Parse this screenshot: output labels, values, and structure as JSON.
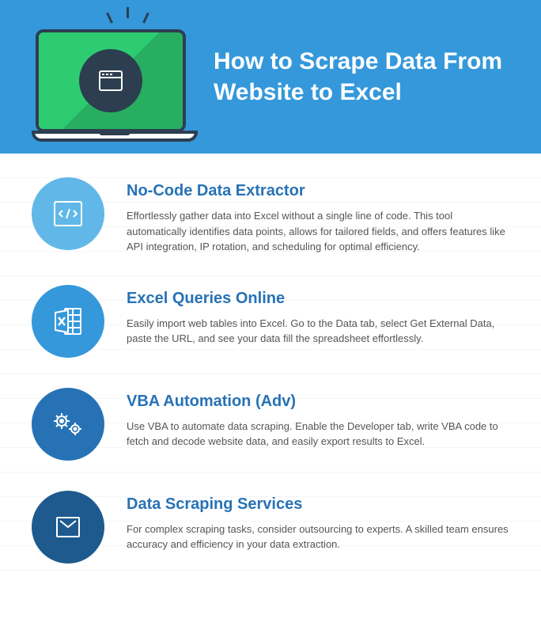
{
  "header": {
    "title": "How to Scrape Data From Website to Excel"
  },
  "items": [
    {
      "title": "No-Code Data Extractor",
      "description": "Effortlessly gather data into Excel without a single line of code. This tool automatically identifies data points, allows for tailored fields, and offers features like API integration, IP rotation, and scheduling for optimal efficiency."
    },
    {
      "title": "Excel Queries Online",
      "description": "Easily import web tables into Excel. Go to the Data tab, select Get External Data, paste the URL, and see your data fill the spreadsheet effortlessly."
    },
    {
      "title": "VBA Automation (Adv)",
      "description": "Use VBA to automate data scraping. Enable the Developer tab, write VBA code to fetch and decode website data, and easily export results to Excel."
    },
    {
      "title": "Data Scraping Services",
      "description": "For complex scraping tasks, consider outsourcing to experts. A skilled team ensures accuracy and efficiency in your data extraction."
    }
  ]
}
